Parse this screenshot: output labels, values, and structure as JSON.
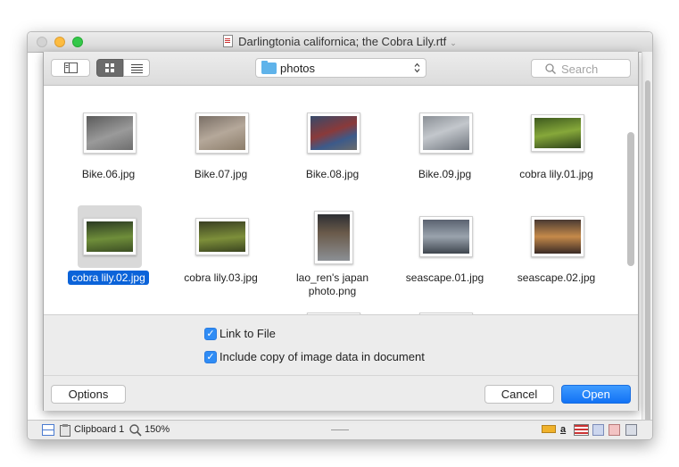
{
  "window": {
    "title": "Darlingtonia californica; the Cobra Lily.rtf"
  },
  "statusbar": {
    "clipboard_label": "Clipboard 1",
    "zoom": "150%"
  },
  "sheet": {
    "location": "photos",
    "search_placeholder": "Search",
    "files": [
      {
        "name": "Bike.06.jpg",
        "selected": false
      },
      {
        "name": "Bike.07.jpg",
        "selected": false
      },
      {
        "name": "Bike.08.jpg",
        "selected": false
      },
      {
        "name": "Bike.09.jpg",
        "selected": false
      },
      {
        "name": "cobra lily.01.jpg",
        "selected": false
      },
      {
        "name": "cobra lily.02.jpg",
        "selected": true
      },
      {
        "name": "cobra lily.03.jpg",
        "selected": false
      },
      {
        "name": "lao_ren's japan photo.png",
        "selected": false
      },
      {
        "name": "seascape.01.jpg",
        "selected": false
      },
      {
        "name": "seascape.02.jpg",
        "selected": false
      }
    ],
    "options": {
      "link_to_file": {
        "label": "Link to File",
        "checked": true
      },
      "include_copy": {
        "label": "Include copy of image data in document",
        "checked": true
      }
    },
    "buttons": {
      "options": "Options",
      "cancel": "Cancel",
      "open": "Open"
    }
  },
  "colors": {
    "accent": "#1272f5",
    "selection": "#0b63d9"
  },
  "icons": [
    "sidebar-icon",
    "icon-view-icon",
    "list-view-icon",
    "folder-icon",
    "updown-chevron-icon",
    "search-icon",
    "checkmark-icon"
  ]
}
